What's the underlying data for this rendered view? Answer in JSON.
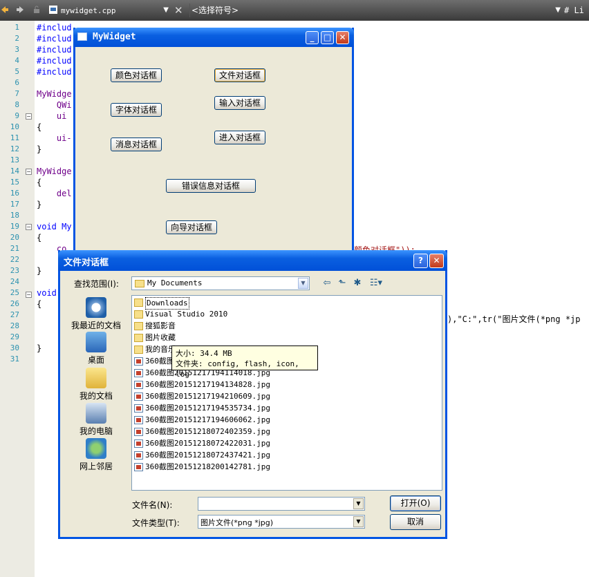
{
  "toolbar": {
    "file_name": "mywidget.cpp",
    "symbol_combo": "<选择符号>",
    "extra": "# Li"
  },
  "editor": {
    "line_numbers": [
      "1",
      "2",
      "3",
      "4",
      "5",
      "6",
      "7",
      "8",
      "9",
      "10",
      "11",
      "12",
      "13",
      "14",
      "15",
      "16",
      "17",
      "18",
      "19",
      "20",
      "21",
      "22",
      "23",
      "24",
      "25",
      "26",
      "27",
      "28",
      "29",
      "30",
      "31"
    ],
    "lines": [
      "#includ",
      "#includ",
      "#includ",
      "#includ",
      "#includ",
      "",
      "MyWidge",
      "    QWi",
      "    ui",
      "{",
      "    ui-",
      "}",
      "",
      "MyWidge",
      "{",
      "    del",
      "}",
      "",
      "void My",
      "{",
      "    co",
      "",
      "}",
      "",
      "void",
      "{",
      "",
      "",
      "",
      "}",
      ""
    ],
    "line21_tail": "颜色对话框\"));",
    "line27_tail": "),\"C:\",tr(\"图片文件(*png *jp"
  },
  "mywidget": {
    "title": "MyWidget",
    "buttons": {
      "color": "颜色对话框",
      "file": "文件对话框",
      "font": "字体对话框",
      "input": "输入对话框",
      "message": "消息对话框",
      "progress": "进入对话框",
      "error": "错误信息对话框",
      "wizard": "向导对话框"
    }
  },
  "filedialog": {
    "title": "文件对话框",
    "lookin_label": "查找范围(I):",
    "lookin_value": "My Documents",
    "places": [
      "我最近的文档",
      "桌面",
      "我的文档",
      "我的电脑",
      "网上邻居"
    ],
    "files": [
      {
        "name": "Downloads",
        "type": "folder"
      },
      {
        "name": "Visual Studio 2010",
        "type": "folder"
      },
      {
        "name": "搜狐影音",
        "type": "folder"
      },
      {
        "name": "图片收藏",
        "type": "folder"
      },
      {
        "name": "我的音乐",
        "type": "folder"
      },
      {
        "name": "360截图20151217194114018.jpg",
        "type": "img"
      },
      {
        "name": "360截图20151217194114018.jpg",
        "type": "img"
      },
      {
        "name": "360截图20151217194134828.jpg",
        "type": "img"
      },
      {
        "name": "360截图20151217194210609.jpg",
        "type": "img"
      },
      {
        "name": "360截图20151217194535734.jpg",
        "type": "img"
      },
      {
        "name": "360截图20151217194606062.jpg",
        "type": "img"
      },
      {
        "name": "360截图20151218072402359.jpg",
        "type": "img"
      },
      {
        "name": "360截图20151218072422031.jpg",
        "type": "img"
      },
      {
        "name": "360截图20151218072437421.jpg",
        "type": "img"
      },
      {
        "name": "360截图20151218200142781.jpg",
        "type": "img"
      }
    ],
    "tooltip": {
      "size": "大小: 34.4 MB",
      "folders": "文件夹: config, flash, icon, log"
    },
    "filename_label": "文件名(N):",
    "filename_value": "",
    "filetype_label": "文件类型(T):",
    "filetype_value": "图片文件(*png *jpg)",
    "open_button": "打开(O)",
    "cancel_button": "取消"
  }
}
